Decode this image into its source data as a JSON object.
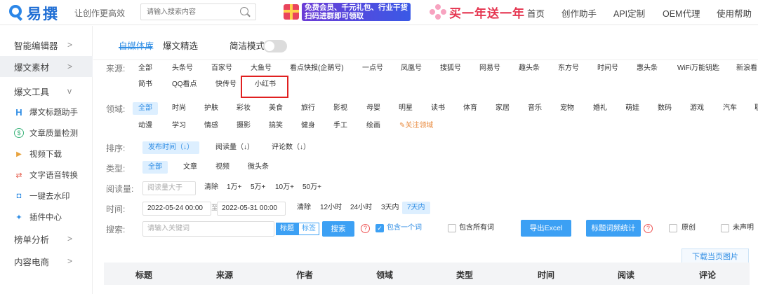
{
  "header": {
    "logo_text": "易撰",
    "slogan": "让创作更高效",
    "search_placeholder": "请输入搜索内容",
    "promo1_line1": "免费会员、千元礼包、行业干货",
    "promo1_line2": "扫码进群即可领取",
    "promo2_text": "买一年送一年",
    "nav": [
      "首页",
      "创作助手",
      "API定制",
      "OEM代理",
      "使用帮助"
    ]
  },
  "sidebar": {
    "items": [
      {
        "label": "智能编辑器",
        "chevron": ">"
      },
      {
        "label": "爆文素材",
        "chevron": ">"
      },
      {
        "label": "爆文工具",
        "chevron": "v"
      }
    ],
    "tools": [
      {
        "icon": "H",
        "label": "爆文标题助手"
      },
      {
        "icon": "$",
        "label": "文章质量检测"
      },
      {
        "icon": "▶",
        "label": "视频下载"
      },
      {
        "icon": "⇄",
        "label": "文字语音转换"
      },
      {
        "icon": "◘",
        "label": "一键去水印"
      },
      {
        "icon": "✦",
        "label": "插件中心"
      }
    ],
    "bottom": [
      {
        "label": "榜单分析",
        "chevron": ">"
      },
      {
        "label": "内容电商",
        "chevron": ">"
      }
    ]
  },
  "tabs": {
    "items": [
      "自媒体库",
      "爆文精选"
    ],
    "active": "自媒体库",
    "simple_mode_label": "简洁模式",
    "simple_mode_on": false
  },
  "filters": {
    "source_label": "来源:",
    "sources_row1": [
      "全部",
      "头条号",
      "百家号",
      "大鱼号",
      "看点快报(企鹅号)",
      "一点号",
      "凤凰号",
      "搜狐号",
      "网易号",
      "趣头条",
      "东方号",
      "时间号",
      "惠头条",
      "WiFi万能钥匙",
      "新浪看"
    ],
    "sources_row2": [
      "简书",
      "QQ看点",
      "快传号",
      "小红书"
    ],
    "domain_label": "领域:",
    "domains_row1": [
      "全部",
      "时尚",
      "护肤",
      "彩妆",
      "美食",
      "旅行",
      "影视",
      "母婴",
      "明星",
      "读书",
      "体育",
      "家居",
      "音乐",
      "宠物",
      "婚礼",
      "萌娃",
      "数码",
      "游戏",
      "汽车",
      "职"
    ],
    "domains_row2": [
      "动漫",
      "学习",
      "情感",
      "摄影",
      "搞笑",
      "健身",
      "手工",
      "绘画"
    ],
    "follow_domain": "关注领域",
    "sort_label": "排序:",
    "sorts": [
      "发布时间（↓）",
      "阅读量（↓）",
      "评论数（↓）"
    ],
    "type_label": "类型:",
    "types": [
      "全部",
      "文章",
      "视频",
      "微头条"
    ],
    "reads_label": "阅读量:",
    "reads_placeholder": "阅读量大于",
    "reads_options": [
      "清除",
      "1万+",
      "5万+",
      "10万+",
      "50万+"
    ],
    "time_label": "时间:",
    "time_start": "2022-05-24 00:00",
    "time_sep": "至",
    "time_end": "2022-05-31 00:00",
    "time_options": [
      "清除",
      "12小时",
      "24小时",
      "3天内",
      "7天内"
    ],
    "search_label": "搜索:",
    "keyword_placeholder": "请输入关键词",
    "seg_title": "标题",
    "seg_tag": "标签",
    "search_button": "搜索",
    "contains_one": "包含一个词",
    "contains_all": "包含所有词",
    "export_excel": "导出Excel",
    "title_stats": "标题词频统计",
    "original": "原创",
    "undeclared": "未声明"
  },
  "download_button": "下载当页图片",
  "table": {
    "columns": [
      "标题",
      "来源",
      "作者",
      "领域",
      "类型",
      "时间",
      "阅读",
      "评论"
    ]
  },
  "colors": {
    "accent": "#2f8de4",
    "highlight": "#e02020",
    "active_side": "#eef0f3"
  }
}
